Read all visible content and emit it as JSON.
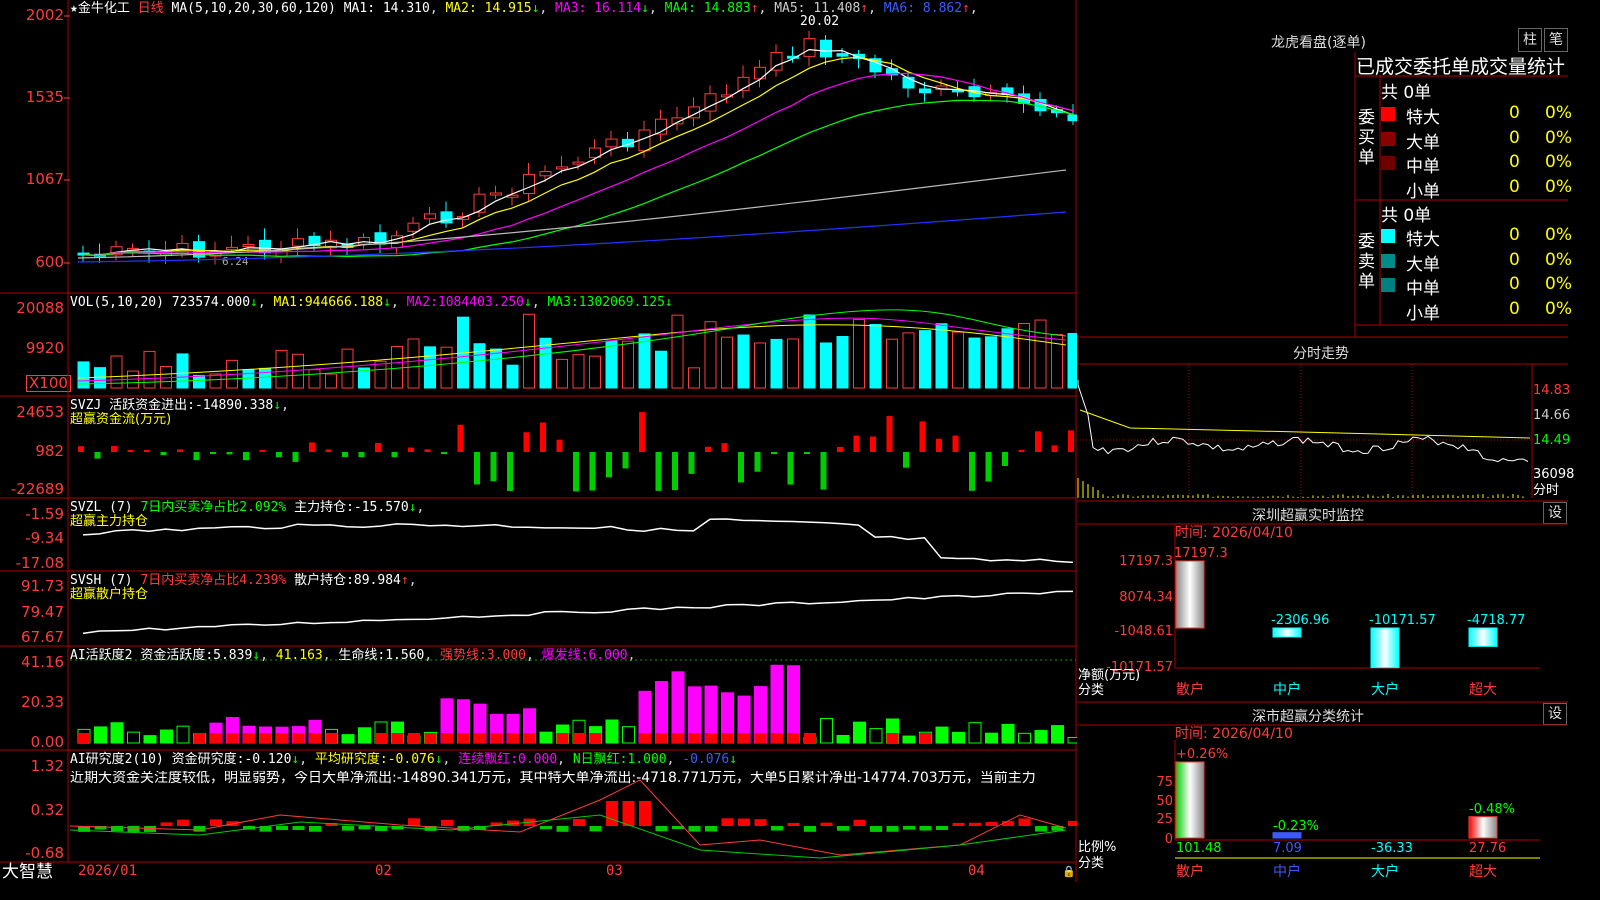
{
  "stock": {
    "star": "★",
    "name": "金牛化工",
    "period": "日线"
  },
  "main": {
    "ma_params": "MA(5,10,20,30,60,120)",
    "ma": [
      {
        "label": "MA1:",
        "value": "14.310",
        "arrow": "",
        "color": "#ffffff"
      },
      {
        "label": "MA2:",
        "value": "14.915",
        "arrow": "↓",
        "color": "#ffff00"
      },
      {
        "label": "MA3:",
        "value": "16.114",
        "arrow": "↓",
        "color": "#ff00ff"
      },
      {
        "label": "MA4:",
        "value": "14.883",
        "arrow": "↑",
        "color": "#00ff00"
      },
      {
        "label": "MA5:",
        "value": "11.408",
        "arrow": "↑",
        "color": "#cccccc"
      },
      {
        "label": "MA6:",
        "value": "8.862",
        "arrow": "↑",
        "color": "#3a5cff"
      }
    ],
    "y_ticks": [
      "2002",
      "1535",
      "1067",
      "600"
    ],
    "high_label": "20.02",
    "low_label": "6.24"
  },
  "vol": {
    "title": "VOL(5,10,20)",
    "value": "723574.000",
    "ma": [
      {
        "label": "MA1:",
        "value": "944666.188",
        "color": "#ffffff"
      },
      {
        "label": "MA2:",
        "value": "1084403.250",
        "color": "#ff00ff"
      },
      {
        "label": "MA3:",
        "value": "1302069.125",
        "color": "#00ff00"
      }
    ],
    "y_ticks": [
      "20088",
      "9920",
      "X100"
    ]
  },
  "svzj": {
    "name": "SVZJ",
    "label": "活跃资金进出:",
    "value": "-14890.338",
    "sub": "超赢资金流(万元)",
    "y_ticks": [
      "24653",
      "982",
      "-22689"
    ]
  },
  "svzl": {
    "name": "SVZL (7)",
    "label1": "7日内买卖净占比2.092%",
    "label2": "主力持仓:",
    "value": "-15.570",
    "sub": "超赢主力持仓",
    "y_ticks": [
      "-1.59",
      "-9.34",
      "-17.08"
    ]
  },
  "svsh": {
    "name": "SVSH (7)",
    "label1": "7日内买卖净占比4.239%",
    "label2": "散户持仓:",
    "value": "89.984",
    "sub": "超赢散户持仓",
    "y_ticks": [
      "91.73",
      "79.47",
      "67.67"
    ]
  },
  "ai1": {
    "name": "AI活跃度2",
    "l1": "资金活跃度:",
    "v1": "5.839",
    "v2": "41.163",
    "l3": "生命线:",
    "v3": "1.560",
    "l4": "强势线:",
    "v4": "3.000",
    "l5": "爆发线:",
    "v5": "6.000",
    "y_ticks": [
      "41.16",
      "20.33",
      "0.00"
    ]
  },
  "ai2": {
    "name": "AI研究度2(10)",
    "l1": "资金研究度:",
    "v1": "-0.120",
    "l2": "平均研究度:",
    "v2": "-0.076",
    "l3": "连续飘红:",
    "v3": "0.000",
    "l4": "N日飘红:",
    "v4": "1.000",
    "v5": "-0.076",
    "y_ticks": [
      "1.32",
      "0.32",
      "-0.68"
    ],
    "comment": "近期大资金关注度较低，明显弱势，今日大单净流出:-14890.341万元，其中特大单净流出:-4718.771万元，大单5日累计净出-14774.703万元，当前主力"
  },
  "bottom": {
    "brand": "大智慧",
    "dates": [
      "2026/01",
      "02",
      "03",
      "04"
    ]
  },
  "dragon": {
    "title": "龙虎看盘(逐单)",
    "btn_bar": "柱",
    "btn_pen": "笔",
    "tabs": [
      "已成交",
      "委托单",
      "成交量",
      "统计"
    ],
    "buy": {
      "side": "委买单",
      "total": "共 0单",
      "rows": [
        {
          "name": "特大",
          "count": "0",
          "pct": "0%",
          "color": "#ff0000"
        },
        {
          "name": "大单",
          "count": "0",
          "pct": "0%",
          "color": "#8b0000"
        },
        {
          "name": "中单",
          "count": "0",
          "pct": "0%",
          "color": "#700000"
        },
        {
          "name": "小单",
          "count": "0",
          "pct": "0%",
          "color": ""
        }
      ]
    },
    "sell": {
      "side": "委卖单",
      "total": "共 0单",
      "rows": [
        {
          "name": "特大",
          "count": "0",
          "pct": "0%",
          "color": "#00ffff"
        },
        {
          "name": "大单",
          "count": "0",
          "pct": "0%",
          "color": "#008b8b"
        },
        {
          "name": "中单",
          "count": "0",
          "pct": "0%",
          "color": "#008080"
        },
        {
          "name": "小单",
          "count": "0",
          "pct": "0%",
          "color": ""
        }
      ]
    }
  },
  "intraday": {
    "title": "分时走势",
    "prices": [
      "14.83",
      "14.66",
      "14.49"
    ],
    "vol": "36098",
    "time_label": "分时"
  },
  "sz_monitor": {
    "title": "深圳超赢实时监控",
    "btn": "设",
    "date": "时间: 2026/04/10",
    "y_ticks": [
      "17197.3",
      "8074.34",
      "-1048.61",
      "-10171.57"
    ],
    "bars": [
      {
        "cat": "散户",
        "value": 17197.3,
        "label": "17197.3"
      },
      {
        "cat": "中户",
        "value": -2306.96,
        "label": "-2306.96"
      },
      {
        "cat": "大户",
        "value": -10171.57,
        "label": "-10171.57"
      },
      {
        "cat": "超大",
        "value": -4718.77,
        "label": "-4718.77"
      }
    ],
    "ylabel": "净额(万元)",
    "xlabel": "分类"
  },
  "sz_classify": {
    "title": "深市超赢分类统计",
    "btn": "设",
    "date": "时间: 2026/04/10",
    "y_ticks": [
      "75",
      "50",
      "25",
      "0"
    ],
    "bars": [
      {
        "cat": "散户",
        "top": "+0.26%",
        "bottom": "101.48",
        "height": 100
      },
      {
        "cat": "中户",
        "top": "-0.23%",
        "bottom": "7.09",
        "height": 7
      },
      {
        "cat": "大户",
        "top": "",
        "bottom": "-36.33",
        "height": 0
      },
      {
        "cat": "超大",
        "top": "-0.48%",
        "bottom": "27.76",
        "height": 28
      }
    ],
    "ylabel": "比例%",
    "xlabel": "分类"
  },
  "colors": {
    "up": "#ff3b3b",
    "down": "#00ffff",
    "grid": "#b00000"
  }
}
